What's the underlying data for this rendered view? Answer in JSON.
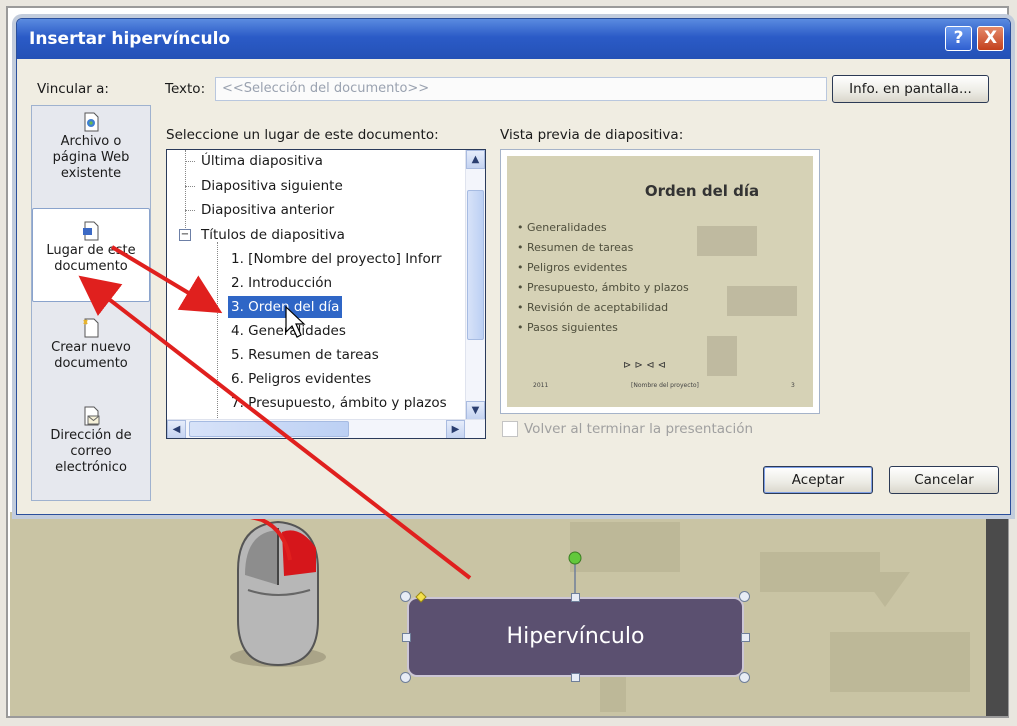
{
  "dialog": {
    "title": "Insertar hipervínculo",
    "help_button": "?",
    "close_button": "X",
    "link_to_label": "Vincular a:",
    "text_label": "Texto:",
    "text_placeholder": "<<Selección del documento>>",
    "screentip_button": "Info. en pantalla...",
    "select_place_label": "Seleccione un lugar de este documento:",
    "preview_label": "Vista previa de diapositiva:",
    "return_checkbox_label": "Volver al terminar la presentación",
    "ok_button": "Aceptar",
    "cancel_button": "Cancelar"
  },
  "link_targets": [
    {
      "line1": "Archivo o",
      "line2": "página Web",
      "line3": "existente",
      "icon": "web-file-icon"
    },
    {
      "line1": "Lugar de este",
      "line2": "documento",
      "line3": "",
      "icon": "document-place-icon",
      "selected": true
    },
    {
      "line1": "Crear nuevo",
      "line2": "documento",
      "line3": "",
      "icon": "new-document-icon"
    },
    {
      "line1": "Dirección de",
      "line2": "correo",
      "line3": "electrónico",
      "icon": "email-icon"
    }
  ],
  "tree_items": [
    "Última diapositiva",
    "Diapositiva siguiente",
    "Diapositiva anterior",
    "Títulos de diapositiva",
    "1. [Nombre del proyecto] Inforr",
    "2. Introducción",
    "3. Orden del día",
    "4. Generalidades",
    "5. Resumen de tareas",
    "6. Peligros evidentes",
    "7. Presupuesto, ámbito y plazos"
  ],
  "tree_expander": "−",
  "selected_tree_item": "3. Orden del día",
  "preview_slide": {
    "title": "Orden del día",
    "bullets": [
      "Generalidades",
      "Resumen de tareas",
      "Peligros evidentes",
      "Presupuesto, ámbito y plazos",
      "Revisión de aceptabilidad",
      "Pasos siguientes"
    ],
    "nav_symbols": "⊳ ⊳ ⊲ ⊲",
    "footer_left": "2011",
    "footer_center": "[Nombre del proyecto]",
    "footer_right": "3"
  },
  "shape_text": "Hipervínculo",
  "colors": {
    "titlebar": "#2b5bc7",
    "selection": "#2f66c6",
    "shape_fill": "#5b5070",
    "annotation_arrow": "#e0201e"
  }
}
